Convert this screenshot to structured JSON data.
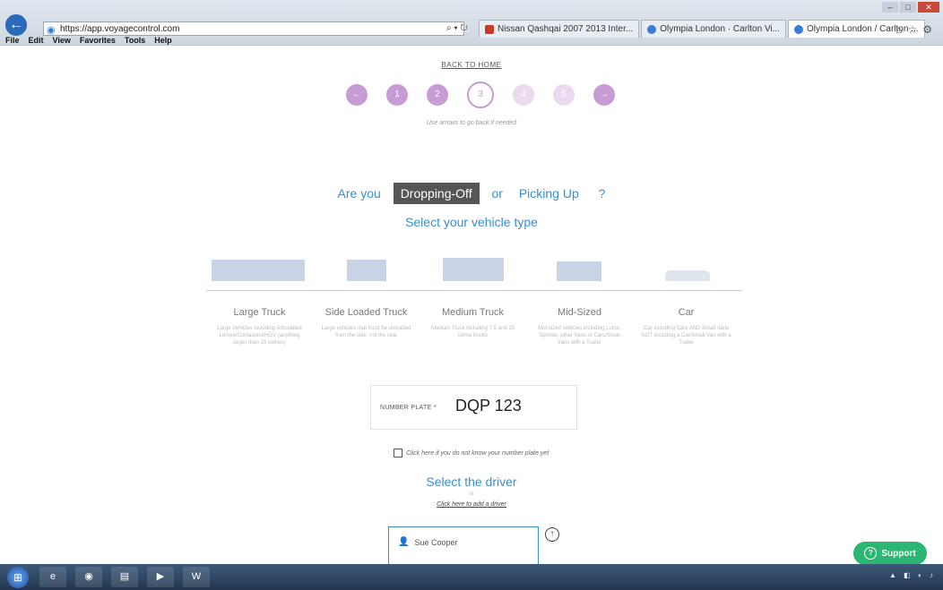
{
  "browser": {
    "address": "https://app.voyagecontrol.com",
    "tabs": [
      {
        "label": "Nissan Qashqai 2007 2013 Inter...",
        "icon": "nissan-icon"
      },
      {
        "label": "Olympia London · Carlton Vi...",
        "icon": "ie-icon"
      },
      {
        "label": "Olympia London / Carlton ...",
        "icon": "ie-icon"
      }
    ],
    "menu": [
      "File",
      "Edit",
      "View",
      "Favorites",
      "Tools",
      "Help"
    ]
  },
  "page": {
    "back_home": "BACK TO HOME",
    "steps": [
      "←",
      "1",
      "2",
      "3",
      "4",
      "5",
      "→"
    ],
    "step_hint": "Use arrows to go back if needed",
    "question_prefix": "Are you",
    "dropping_off": "Dropping-Off",
    "or": "or",
    "picking_up": "Picking Up",
    "question_suffix": "?",
    "vehicle_heading": "Select your vehicle type",
    "vehicles": [
      {
        "name": "Large Truck",
        "desc": "Large Vehicles including Articulated Lorries/Containers/HGV (anything larger than 15 tonnes)"
      },
      {
        "name": "Side Loaded Truck",
        "desc": "Large vehicles that must be unloaded from the side, not the rear"
      },
      {
        "name": "Medium Truck",
        "desc": "Medium Truck including 7.5 and 15 tonne trucks"
      },
      {
        "name": "Mid-Sized",
        "desc": "Mid-sized vehicles including Luton, Sprinter, other Vans or Cars/Small Vans with a Trailer"
      },
      {
        "name": "Car",
        "desc": "Car including Cars AND Small Vans NOT including a Car/Small Van with a Trailer"
      }
    ],
    "plate_label": "NUMBER PLATE *",
    "plate_value": "DQP 123",
    "unknown_plate": "Click here if you do not know your number plate yet",
    "driver_heading": "Select the driver",
    "driver_or": "or",
    "add_driver": "Click here to add a driver",
    "driver_name": "Sue Cooper",
    "support": "Support"
  },
  "colors": {
    "accent": "#3a8fc9",
    "step": "#c79bd3",
    "support": "#2bb673"
  }
}
